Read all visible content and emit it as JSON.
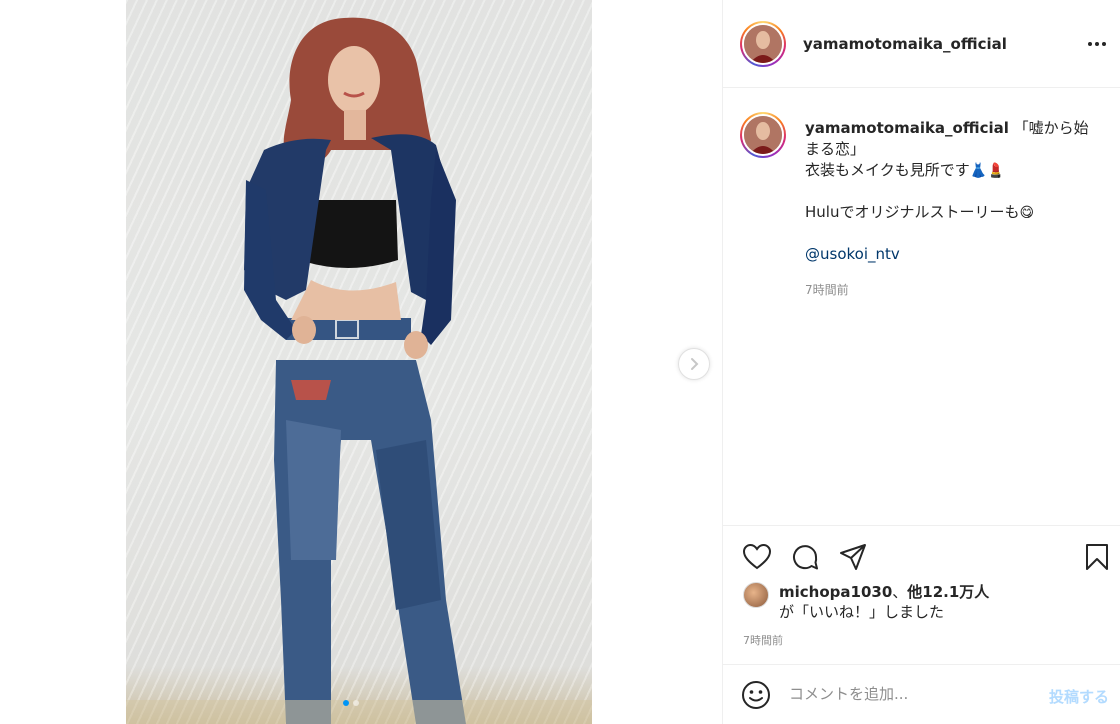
{
  "post": {
    "username": "yamamotomaika_official",
    "caption": {
      "line1": "「嘘から始",
      "line2": "まる恋」",
      "line3": "衣装もメイクも見所です",
      "line3_emoji": "👗💄",
      "line4": "Huluでオリジナルストーリーも",
      "line4_emoji": "😋",
      "mention": "@usokoi_ntv"
    },
    "caption_time": "7時間前",
    "likes": {
      "liker": "michopa1030",
      "separator": "、",
      "others": "他12.1万人",
      "suffix": "が「いいね！」しました"
    },
    "post_time": "7時間前"
  },
  "comment": {
    "placeholder": "コメントを追加...",
    "post_label": "投稿する"
  },
  "carousel": {
    "slides": 2,
    "current": 1
  },
  "colors": {
    "accent": "#0095f6",
    "mention": "#00376b",
    "muted": "#8e8e8e",
    "post_disabled": "#b3dbff"
  },
  "icons": [
    "more-options-icon",
    "heart-icon",
    "comment-icon",
    "share-icon",
    "bookmark-icon",
    "emoji-icon",
    "chevron-right-icon"
  ]
}
